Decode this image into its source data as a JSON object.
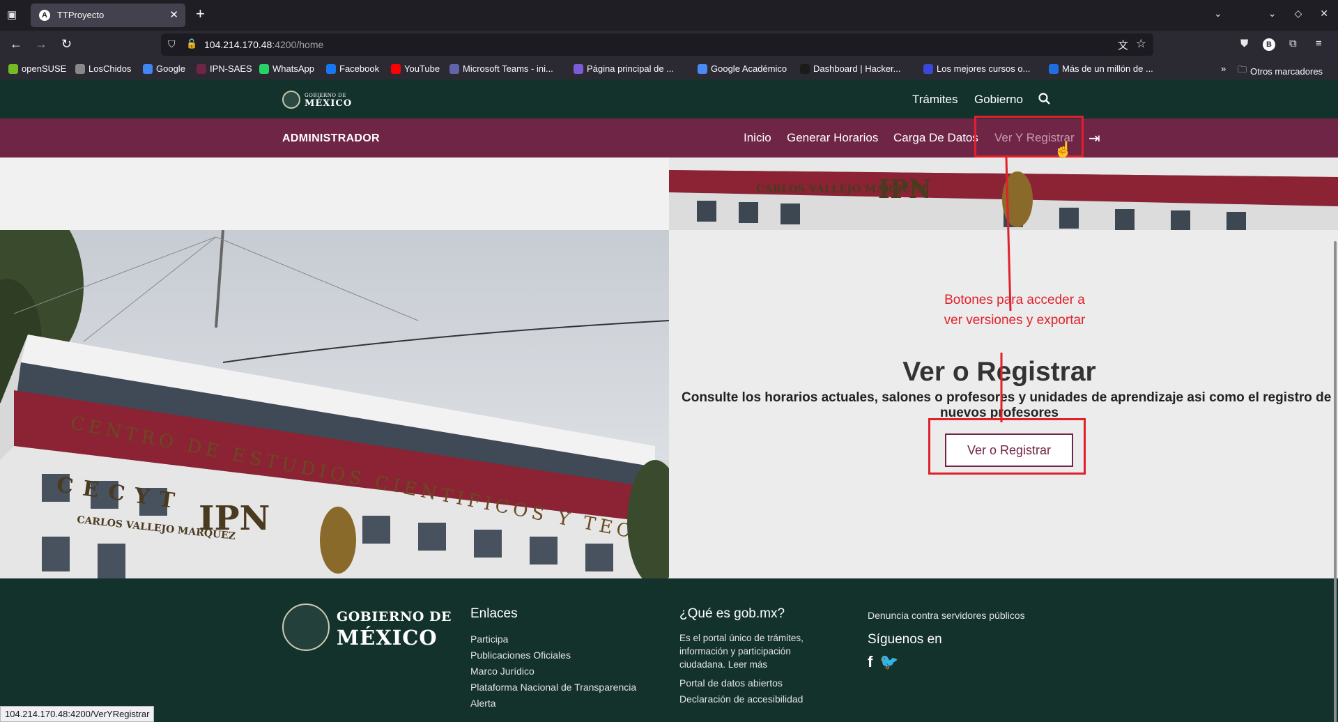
{
  "browser": {
    "tab_title": "TTProyecto",
    "tab_favicon": "A",
    "url_host": "104.214.170.48",
    "url_rest": ":4200/home",
    "status_url": "104.214.170.48:4200/VerYRegistrar",
    "profile_initial": "B"
  },
  "bookmarks": [
    {
      "label": "openSUSE",
      "color": "#73ba25"
    },
    {
      "label": "LosChidos",
      "color": "#888888"
    },
    {
      "label": "Google",
      "color": "#4285f4"
    },
    {
      "label": "IPN-SAES",
      "color": "#6f2546"
    },
    {
      "label": "WhatsApp",
      "color": "#25d366"
    },
    {
      "label": "Facebook",
      "color": "#1877f2"
    },
    {
      "label": "YouTube",
      "color": "#ff0000"
    },
    {
      "label": "Microsoft Teams - ini...",
      "color": "#6264a7"
    },
    {
      "label": "Página principal de ...",
      "color": "#7b5cd6"
    },
    {
      "label": "Google Académico",
      "color": "#4a8af4"
    },
    {
      "label": "Dashboard | Hacker...",
      "color": "#1b1b1b"
    },
    {
      "label": "Los mejores cursos o...",
      "color": "#3b47d9"
    },
    {
      "label": "Más de un millón de ...",
      "color": "#1e6fe0"
    }
  ],
  "bookmarks_other": "Otros marcadores",
  "gob_header": {
    "logo_line1": "GOBIERNO DE",
    "logo_line2": "MÉXICO",
    "nav": [
      "Trámites",
      "Gobierno"
    ]
  },
  "admin_nav": {
    "brand": "ADMINISTRADOR",
    "items": [
      "Inicio",
      "Generar Horarios",
      "Carga De Datos",
      "Ver Y Registrar"
    ]
  },
  "hero": {
    "title": "Ver o Registrar",
    "description": "Consulte los horarios actuales, salones o profesores y unidades de aprendizaje asi como el registro de",
    "description_cont": "nuevos profesores",
    "button": "Ver o Registrar"
  },
  "annotation": {
    "line1": "Botones para acceder a",
    "line2": "ver versiones y exportar",
    "color": "#e0202a"
  },
  "footer": {
    "logo_line1": "GOBIERNO DE",
    "logo_line2": "MÉXICO",
    "enlaces_title": "Enlaces",
    "enlaces": [
      "Participa",
      "Publicaciones Oficiales",
      "Marco Jurídico",
      "Plataforma Nacional de Transparencia",
      "Alerta"
    ],
    "que_es_title": "¿Qué es gob.mx?",
    "que_es_text": [
      "Es el portal único de trámites,",
      "información y participación",
      "ciudadana. Leer más"
    ],
    "que_es_links": [
      "Portal de datos abiertos",
      "Declaración de accesibilidad"
    ],
    "denuncia": "Denuncia contra servidores públicos",
    "siguenos": "Síguenos en",
    "social": [
      "f",
      "🐦"
    ]
  },
  "colors": {
    "gob_green": "#13322b",
    "admin_wine": "#6f2546",
    "annotation_red": "#e0202a"
  }
}
